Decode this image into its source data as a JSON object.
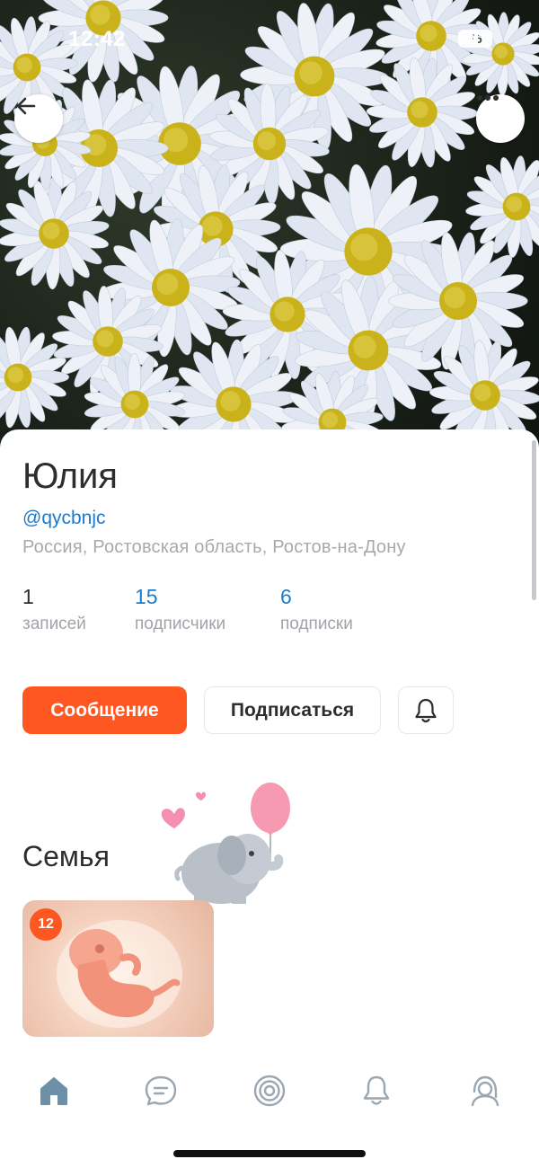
{
  "status_bar": {
    "time": "12:42",
    "battery": "76",
    "icons": [
      "signal-icon",
      "wifi-icon",
      "battery-icon"
    ]
  },
  "header": {
    "back_icon": "arrow-left-icon",
    "more_icon": "more-horizontal-icon"
  },
  "profile": {
    "name": "Юлия",
    "handle": "@qycbnjc",
    "location": "Россия, Ростовская область, Ростов-на-Дону"
  },
  "stats": {
    "posts": {
      "value": "1",
      "label": "записей"
    },
    "followers": {
      "value": "15",
      "label": "подписчики"
    },
    "following": {
      "value": "6",
      "label": "подписки"
    }
  },
  "actions": {
    "message_label": "Сообщение",
    "subscribe_label": "Подписаться",
    "bell_icon": "bell-icon"
  },
  "family": {
    "title": "Семья",
    "card_week": "12"
  },
  "tabbar": {
    "items": [
      {
        "icon": "home-icon",
        "active": true
      },
      {
        "icon": "chat-icon",
        "active": false
      },
      {
        "icon": "target-icon",
        "active": false
      },
      {
        "icon": "bell-icon",
        "active": false
      },
      {
        "icon": "profile-icon",
        "active": false
      }
    ]
  },
  "colors": {
    "accent": "#ff5722",
    "link": "#1f7ac9",
    "text": "#2c2d2e",
    "muted": "#a7a9ad",
    "tab_active": "#6d8fa8",
    "tab_inactive": "#9aa6b2"
  }
}
